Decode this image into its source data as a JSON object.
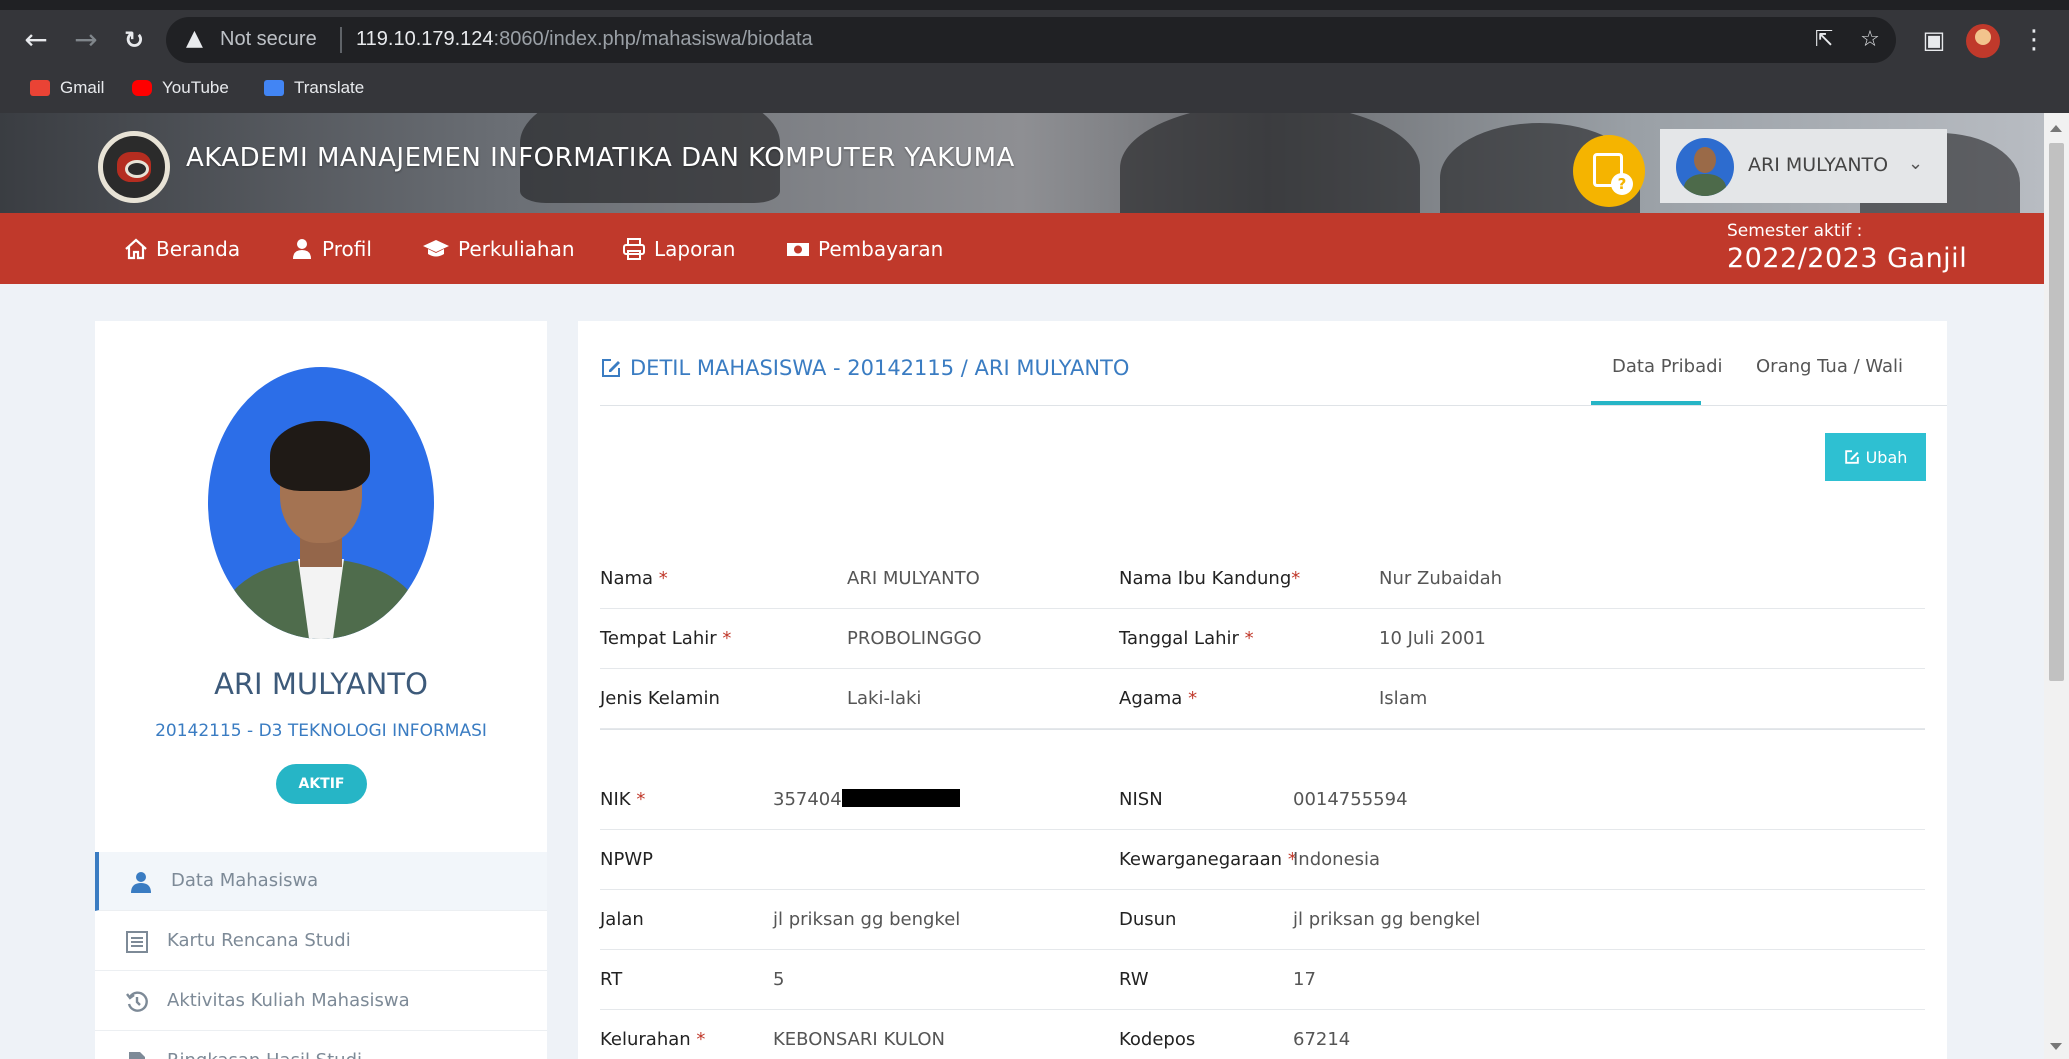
{
  "browser": {
    "not_secure": "Not secure",
    "url_host": "119.10.179.124",
    "url_rest": ":8060/index.php/mahasiswa/biodata",
    "bookmarks": [
      {
        "label": "Gmail",
        "color": "#ea4335"
      },
      {
        "label": "YouTube",
        "color": "#ff0000"
      },
      {
        "label": "Translate",
        "color": "#4285f4"
      }
    ]
  },
  "header": {
    "title": "AKADEMI MANAJEMEN INFORMATIKA DAN KOMPUTER YAKUMA",
    "user_name": "ARI MULYANTO"
  },
  "nav": {
    "items": [
      {
        "label": "Beranda",
        "icon": "home-icon"
      },
      {
        "label": "Profil",
        "icon": "user-icon"
      },
      {
        "label": "Perkuliahan",
        "icon": "graduation-cap-icon"
      },
      {
        "label": "Laporan",
        "icon": "printer-icon"
      },
      {
        "label": "Pembayaran",
        "icon": "money-icon"
      }
    ],
    "semester_label": "Semester aktif :",
    "semester_value": "2022/2023 Ganjil"
  },
  "profile": {
    "name": "ARI MULYANTO",
    "id_program": "20142115 - D3 TEKNOLOGI INFORMASI",
    "status": "AKTIF"
  },
  "sidebar": {
    "items": [
      {
        "label": "Data Mahasiswa",
        "icon": "user-icon",
        "active": true
      },
      {
        "label": "Kartu Rencana Studi",
        "icon": "list-icon",
        "active": false
      },
      {
        "label": "Aktivitas Kuliah Mahasiswa",
        "icon": "history-icon",
        "active": false
      },
      {
        "label": "Ringkasan Hasil Studi",
        "icon": "file-icon",
        "active": false
      }
    ]
  },
  "detail": {
    "title": "DETIL MAHASISWA - 20142115 / ARI MULYANTO",
    "tabs": [
      "Data Pribadi",
      "Orang Tua / Wali"
    ],
    "edit_label": "Ubah",
    "required_mark": "*",
    "personal": [
      {
        "l_label": "Nama",
        "l_req": true,
        "l_value": "ARI MULYANTO",
        "r_label": "Nama Ibu Kandung",
        "r_req": true,
        "r_value": "Nur Zubaidah"
      },
      {
        "l_label": "Tempat Lahir",
        "l_req": true,
        "l_value": "PROBOLINGGO",
        "r_label": "Tanggal Lahir",
        "r_req": true,
        "r_value": "10 Juli 2001"
      },
      {
        "l_label": "Jenis Kelamin",
        "l_req": false,
        "l_value": "Laki-laki",
        "r_label": "Agama",
        "r_req": true,
        "r_value": "Islam"
      }
    ],
    "identity": [
      {
        "l_label": "NIK",
        "l_req": true,
        "l_value": "357404",
        "redacted": true,
        "r_label": "NISN",
        "r_req": false,
        "r_value": "0014755594"
      },
      {
        "l_label": "NPWP",
        "l_req": false,
        "l_value": "",
        "r_label": "Kewarganegaraan",
        "r_req": true,
        "r_value": "Indonesia"
      },
      {
        "l_label": "Jalan",
        "l_req": false,
        "l_value": "jl priksan gg bengkel",
        "r_label": "Dusun",
        "r_req": false,
        "r_value": "jl priksan gg bengkel"
      },
      {
        "l_label": "RT",
        "l_req": false,
        "l_value": "5",
        "r_label": "RW",
        "r_req": false,
        "r_value": "17"
      },
      {
        "l_label": "Kelurahan",
        "l_req": true,
        "l_value": "KEBONSARI KULON",
        "r_label": "Kodepos",
        "r_req": false,
        "r_value": "67214"
      }
    ]
  }
}
